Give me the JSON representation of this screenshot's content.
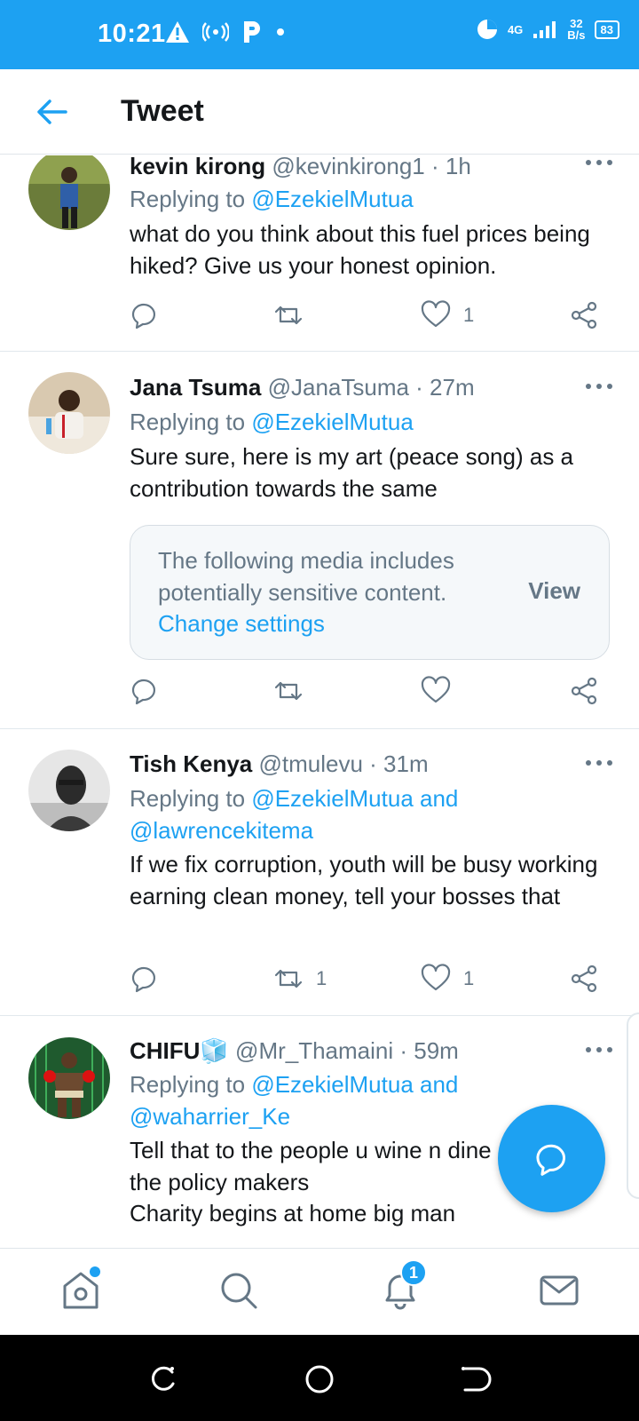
{
  "status_bar": {
    "time": "10:21",
    "network_type": "4G",
    "speed_value": "32",
    "speed_unit": "B/s",
    "battery": "83",
    "bg_color": "#1da1f2"
  },
  "app_bar": {
    "title": "Tweet"
  },
  "tweets": [
    {
      "name": "kevin kirong",
      "meta": "@kevinkirong1 · 1h",
      "replying_prefix": "Replying to ",
      "mentions": "@EzekielMutua",
      "text": "what do you think about this fuel prices being hiked? Give us your honest opinion.",
      "retweets": "",
      "likes": "1"
    },
    {
      "name": "Jana Tsuma",
      "meta": "@JanaTsuma · 27m",
      "replying_prefix": "Replying to ",
      "mentions": "@EzekielMutua",
      "text": "Sure sure, here is my art (peace song) as a contribution towards the same",
      "sensitive_message": "The following media includes potentially sensitive content.",
      "sensitive_link": "Change settings",
      "sensitive_view": "View",
      "retweets": "",
      "likes": ""
    },
    {
      "name": "Tish Kenya",
      "meta": "@tmulevu · 31m",
      "replying_prefix": "Replying to ",
      "mentions_line1": "@EzekielMutua and",
      "mentions_line2": "@lawrencekitema",
      "text": "If we fix corruption, youth will be busy working earning clean money, tell your bosses that",
      "retweets": "1",
      "likes": "1"
    },
    {
      "name": "CHIFU🧊",
      "meta": "@Mr_Thamaini · 59m",
      "replying_prefix": "Replying to ",
      "mentions_line1": "@EzekielMutua and",
      "mentions_line2": "@waharrier_Ke",
      "text_line1": "Tell that to the people u wine n dine",
      "text_line2": "the policy makers",
      "text_line3": "Charity begins at home big man"
    }
  ],
  "bottom_nav": {
    "notifications_badge": "1",
    "items": [
      "home-icon",
      "search-icon",
      "notifications-icon",
      "messages-icon"
    ]
  },
  "colors": {
    "accent": "#1da1f2",
    "secondary_text": "#657786",
    "primary_text": "#14171a"
  }
}
